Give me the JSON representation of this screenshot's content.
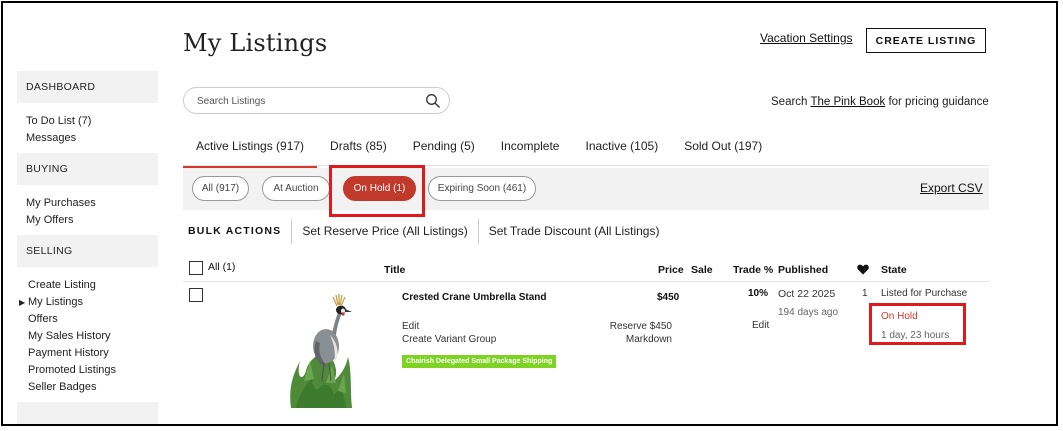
{
  "header": {
    "title": "My Listings",
    "vacation_link": "Vacation Settings",
    "create_button": "CREATE LISTING"
  },
  "sidebar": {
    "sections": [
      {
        "heading": "DASHBOARD",
        "items": [
          "To Do List (7)",
          "Messages"
        ]
      },
      {
        "heading": "BUYING",
        "items": [
          "My Purchases",
          "My Offers"
        ]
      },
      {
        "heading": "SELLING",
        "items": [
          "Create Listing",
          "My Listings",
          "Offers",
          "My Sales History",
          "Payment History",
          "Promoted Listings",
          "Seller Badges"
        ]
      }
    ],
    "active_item": "My Listings"
  },
  "search": {
    "placeholder": "Search Listings",
    "value": ""
  },
  "pink_book": {
    "prefix": "Search",
    "link": "The Pink Book",
    "suffix": "for pricing guidance"
  },
  "tabs": [
    {
      "label": "Active Listings (917)",
      "active": true
    },
    {
      "label": "Drafts (85)"
    },
    {
      "label": "Pending (5)"
    },
    {
      "label": "Incomplete"
    },
    {
      "label": "Inactive (105)"
    },
    {
      "label": "Sold Out (197)"
    }
  ],
  "filters": [
    {
      "label": "All (917)"
    },
    {
      "label": "At Auction"
    },
    {
      "label": "On Hold (1)",
      "active": true
    },
    {
      "label": "Expiring Soon (461)"
    }
  ],
  "export_link": "Export CSV",
  "bulk": {
    "label": "BULK ACTIONS",
    "actions": [
      "Set Reserve Price (All Listings)",
      "Set Trade Discount (All Listings)"
    ]
  },
  "table": {
    "select_all": "All (1)",
    "columns": {
      "title": "Title",
      "price": "Price",
      "sale": "Sale",
      "trade": "Trade %",
      "published": "Published",
      "favorites_icon": "heart-icon",
      "state": "State"
    },
    "rows": [
      {
        "title": "Crested Crane Umbrella Stand",
        "edit": "Edit",
        "variant": "Create Variant Group",
        "shipping_badge": "Chairish Delegated Small Package Shipping",
        "price": "$450",
        "reserve": "Reserve $450",
        "markdown": "Markdown",
        "trade": "10%",
        "trade_edit": "Edit",
        "published": "Oct 22 2025",
        "published_ago": "194 days ago",
        "favorites": "1",
        "state": "Listed for Purchase",
        "hold_status": "On Hold",
        "hold_time": "1 day, 23 hours"
      }
    ]
  },
  "colors": {
    "accent_red": "#c0392b",
    "highlight_red": "#e01a1a",
    "badge_green": "#7ed321",
    "panel_gray": "#f2f2f2"
  }
}
